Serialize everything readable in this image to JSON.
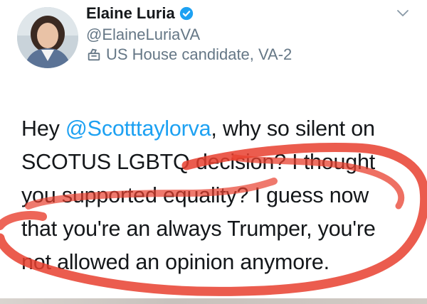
{
  "profile": {
    "name": "Elaine Luria",
    "handle": "@ElaineLuriaVA",
    "label": "US House candidate, VA-2",
    "verified_icon": "verified-badge-icon",
    "label_icon": "ballot-box-icon"
  },
  "tweet": {
    "prefix": "Hey ",
    "mention": "@Scotttaylorva",
    "body": ", why so silent on SCOTUS LGBTQ decision? I thought you supported equality? I guess now that you're an always Trumper, you're not allowed an opinion anymore."
  },
  "colors": {
    "accent": "#1da1f2",
    "annotation": "#e8402f"
  }
}
